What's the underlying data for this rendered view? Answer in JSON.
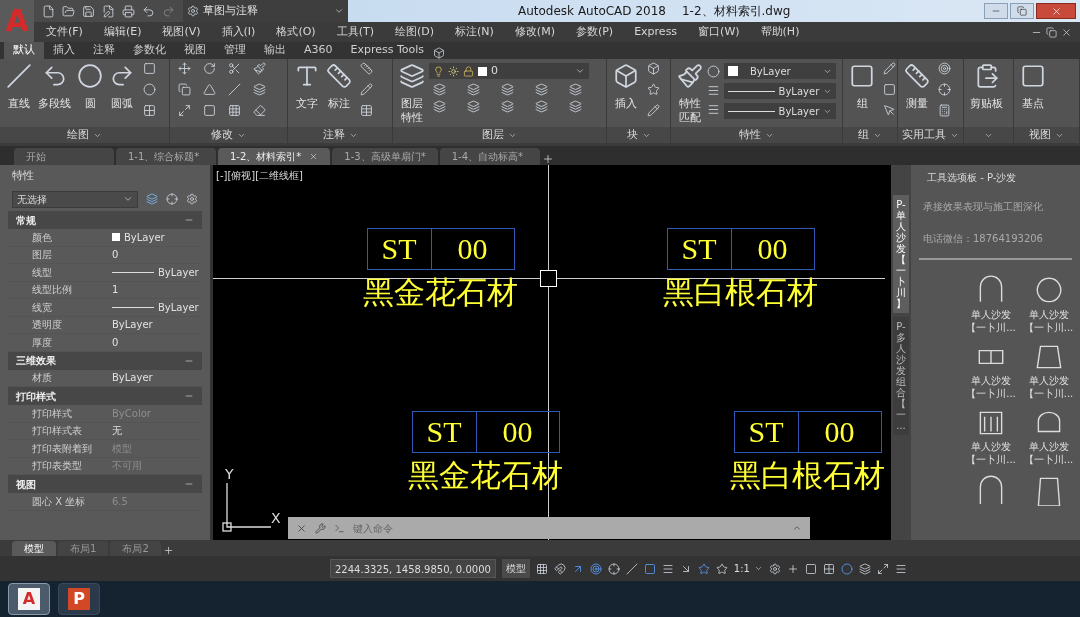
{
  "app_logo": "A",
  "quick_access": {
    "workspace": "草图与注释"
  },
  "window": {
    "title": "Autodesk AutoCAD 2018",
    "file": "1-2、材料索引.dwg"
  },
  "menu": [
    "文件(F)",
    "编辑(E)",
    "视图(V)",
    "插入(I)",
    "格式(O)",
    "工具(T)",
    "绘图(D)",
    "标注(N)",
    "修改(M)",
    "参数(P)",
    "Express",
    "窗口(W)",
    "帮助(H)"
  ],
  "ribbon_tabs": [
    {
      "label": "默认",
      "selected": true
    },
    {
      "label": "插入",
      "selected": false
    },
    {
      "label": "注释",
      "selected": false
    },
    {
      "label": "参数化",
      "selected": false
    },
    {
      "label": "视图",
      "selected": false
    },
    {
      "label": "管理",
      "selected": false
    },
    {
      "label": "输出",
      "selected": false
    },
    {
      "label": "A360",
      "selected": false
    },
    {
      "label": "Express Tools",
      "selected": false
    }
  ],
  "ribbon_panels": [
    {
      "title": "绘图",
      "buttons": [
        "直线",
        "多段线",
        "圆",
        "圆弧"
      ]
    },
    {
      "title": "修改"
    },
    {
      "title": "注释",
      "buttons": [
        "文字",
        "标注"
      ]
    },
    {
      "title": "图层",
      "buttons": [
        "图层特性"
      ],
      "layer": "0"
    },
    {
      "title": "块",
      "buttons": [
        "插入"
      ]
    },
    {
      "title": "特性",
      "buttons": [
        "特性匹配"
      ],
      "combos": [
        {
          "kind": "color",
          "value": "ByLayer"
        },
        {
          "kind": "line",
          "value": "ByLayer"
        },
        {
          "kind": "line",
          "value": "ByLayer"
        }
      ]
    },
    {
      "title": "组",
      "buttons": [
        "组"
      ]
    },
    {
      "title": "实用工具",
      "buttons": [
        "测量"
      ]
    },
    {
      "buttons": [
        "剪贴板"
      ]
    },
    {
      "title": "视图",
      "buttons": [
        "基点"
      ]
    }
  ],
  "doc_tabs": [
    {
      "label": "开始",
      "selected": false
    },
    {
      "label": "1-1、综合标题*",
      "selected": false
    },
    {
      "label": "1-2、材料索引*",
      "selected": true
    },
    {
      "label": "1-3、高级单扇门*",
      "selected": false
    },
    {
      "label": "1-4、自动标高*",
      "selected": false
    }
  ],
  "properties": {
    "title": "特性",
    "selection": "无选择",
    "sections": [
      {
        "title": "常规",
        "expanded": true,
        "rows": [
          {
            "label": "颜色",
            "value": "ByLayer",
            "kind": "color",
            "disabled": false
          },
          {
            "label": "图层",
            "value": "0",
            "kind": "text",
            "disabled": false
          },
          {
            "label": "线型",
            "value": "ByLayer",
            "kind": "line",
            "disabled": false
          },
          {
            "label": "线型比例",
            "value": "1",
            "kind": "text",
            "disabled": false
          },
          {
            "label": "线宽",
            "value": "ByLayer",
            "kind": "line",
            "disabled": false
          },
          {
            "label": "透明度",
            "value": "ByLayer",
            "kind": "text",
            "disabled": false
          },
          {
            "label": "厚度",
            "value": "0",
            "kind": "text",
            "disabled": false
          }
        ]
      },
      {
        "title": "三维效果",
        "expanded": true,
        "rows": [
          {
            "label": "材质",
            "value": "ByLayer",
            "kind": "text",
            "disabled": false
          }
        ]
      },
      {
        "title": "打印样式",
        "expanded": true,
        "rows": [
          {
            "label": "打印样式",
            "value": "ByColor",
            "kind": "text",
            "disabled": true
          },
          {
            "label": "打印样式表",
            "value": "无",
            "kind": "text",
            "disabled": false
          },
          {
            "label": "打印表附着到",
            "value": "模型",
            "kind": "text",
            "disabled": true
          },
          {
            "label": "打印表类型",
            "value": "不可用",
            "kind": "text",
            "disabled": true
          }
        ]
      },
      {
        "title": "视图",
        "expanded": true,
        "rows": [
          {
            "label": "圆心 X 坐标",
            "value": "6.5",
            "kind": "text",
            "disabled": true
          }
        ]
      }
    ]
  },
  "canvas": {
    "view_label": "[-][俯视][二维线框]",
    "tags": [
      {
        "code": "ST",
        "number": "00",
        "material": "黑金花石材"
      },
      {
        "code": "ST",
        "number": "00",
        "material": "黑白根石材"
      },
      {
        "code": "ST",
        "number": "00",
        "material": "黑金花石材"
      },
      {
        "code": "ST",
        "number": "00",
        "material": "黑白根石材"
      }
    ],
    "ucs": {
      "y": "Y",
      "x": "X"
    },
    "command": {
      "placeholder": "键入命令"
    }
  },
  "tool_palette": {
    "title": "工具选项板 - P-沙发",
    "tabs": [
      {
        "label": "P-单人沙发【一卜川】",
        "selected": true
      },
      {
        "label": "P-多人沙发组合【一...",
        "selected": false
      }
    ],
    "description": [
      "承接效果表现与施工图深化",
      "电话微信：18764193206"
    ],
    "items": [
      {
        "kind": "labeled",
        "name": "单人沙发",
        "source": "【一卜川..."
      },
      {
        "kind": "labeled",
        "name": "单人沙发",
        "source": "【一卜川..."
      },
      {
        "kind": "labeled",
        "name": "单人沙发",
        "source": "【一卜川..."
      },
      {
        "kind": "labeled",
        "name": "单人沙发",
        "source": "【一卜川..."
      },
      {
        "kind": "labeled",
        "name": "单人沙发",
        "source": "【一卜川..."
      },
      {
        "kind": "labeled",
        "name": "单人沙发",
        "source": "【一卜川..."
      },
      {
        "kind": "icon_only"
      },
      {
        "kind": "icon_only"
      }
    ]
  },
  "layout_tabs": [
    {
      "label": "模型",
      "selected": true
    },
    {
      "label": "布局1",
      "selected": false
    },
    {
      "label": "布局2",
      "selected": false
    }
  ],
  "status_bar": {
    "coordinates": "2244.3325, 1458.9850, 0.0000",
    "space": "模型",
    "scale": "1:1"
  },
  "taskbar": [
    {
      "label": "A",
      "selected": true
    },
    {
      "label": "P",
      "selected": false
    }
  ]
}
